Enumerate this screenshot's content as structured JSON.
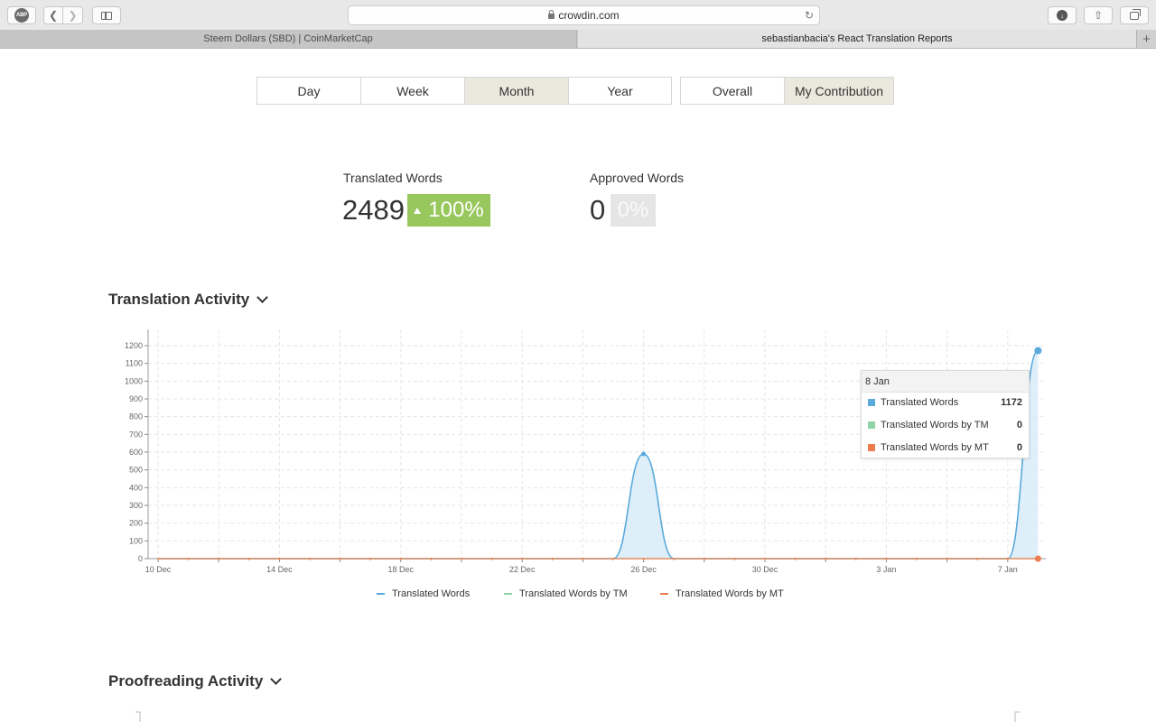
{
  "browser": {
    "url": "crowdin.com",
    "tabs": [
      {
        "label": "Steem Dollars (SBD) | CoinMarketCap"
      },
      {
        "label": "sebastianbacia's React Translation Reports"
      }
    ],
    "abp_label": "ABP",
    "new_tab": "+"
  },
  "period_buttons": [
    {
      "label": "Day",
      "active": false
    },
    {
      "label": "Week",
      "active": false
    },
    {
      "label": "Month",
      "active": true
    },
    {
      "label": "Year",
      "active": false
    }
  ],
  "scope_buttons": [
    {
      "label": "Overall",
      "active": false
    },
    {
      "label": "My Contribution",
      "active": true
    }
  ],
  "stats": {
    "translated": {
      "label": "Translated Words",
      "value": "2489",
      "change": "100%"
    },
    "approved": {
      "label": "Approved Words",
      "value": "0",
      "change": "0%"
    }
  },
  "sections": {
    "translation_activity": "Translation Activity",
    "proofreading_activity": "Proofreading Activity"
  },
  "tooltip": {
    "date": "8 Jan",
    "rows": [
      {
        "name": "Translated Words",
        "value": "1172",
        "color": "#5aaadb"
      },
      {
        "name": "Translated Words by TM",
        "value": "0",
        "color": "#8fd3a6"
      },
      {
        "name": "Translated Words by MT",
        "value": "0",
        "color": "#ee7d4e"
      }
    ]
  },
  "colors": {
    "translated": "#5aaadb",
    "tm": "#8fd3a6",
    "mt": "#ee7d4e",
    "area_fill": "#d9ecf8",
    "active_button": "#ebe8dd",
    "positive_badge": "#98c75d"
  },
  "chart_data": {
    "type": "area",
    "ylim": [
      0,
      1200
    ],
    "yticks": [
      0,
      100,
      200,
      300,
      400,
      500,
      600,
      700,
      800,
      900,
      1000,
      1100,
      1200
    ],
    "x_start_day": "10 Dec",
    "x_tick_labels": [
      "10 Dec",
      "14 Dec",
      "18 Dec",
      "22 Dec",
      "26 Dec",
      "30 Dec",
      "3 Jan",
      "7 Jan"
    ],
    "x_categories": [
      "10 Dec",
      "11 Dec",
      "12 Dec",
      "13 Dec",
      "14 Dec",
      "15 Dec",
      "16 Dec",
      "17 Dec",
      "18 Dec",
      "19 Dec",
      "20 Dec",
      "21 Dec",
      "22 Dec",
      "23 Dec",
      "24 Dec",
      "25 Dec",
      "26 Dec",
      "27 Dec",
      "28 Dec",
      "29 Dec",
      "30 Dec",
      "31 Dec",
      "1 Jan",
      "2 Jan",
      "3 Jan",
      "4 Jan",
      "5 Jan",
      "6 Jan",
      "7 Jan",
      "8 Jan"
    ],
    "series": [
      {
        "name": "Translated Words",
        "values": [
          0,
          0,
          0,
          0,
          0,
          0,
          0,
          0,
          0,
          0,
          0,
          0,
          0,
          0,
          0,
          0,
          590,
          0,
          0,
          0,
          0,
          0,
          0,
          0,
          0,
          0,
          0,
          0,
          0,
          1172
        ]
      },
      {
        "name": "Translated Words by TM",
        "values": [
          0,
          0,
          0,
          0,
          0,
          0,
          0,
          0,
          0,
          0,
          0,
          0,
          0,
          0,
          0,
          0,
          0,
          0,
          0,
          0,
          0,
          0,
          0,
          0,
          0,
          0,
          0,
          0,
          0,
          0
        ]
      },
      {
        "name": "Translated Words by MT",
        "values": [
          0,
          0,
          0,
          0,
          0,
          0,
          0,
          0,
          0,
          0,
          0,
          0,
          0,
          0,
          0,
          0,
          0,
          0,
          0,
          0,
          0,
          0,
          0,
          0,
          0,
          0,
          0,
          0,
          0,
          0
        ]
      }
    ]
  }
}
